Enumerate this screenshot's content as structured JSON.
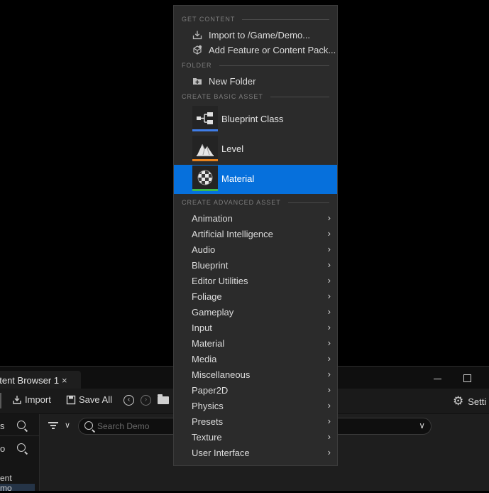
{
  "content_browser": {
    "tab_label": "ntent Browser 1",
    "tab_close": "×",
    "toolbar": {
      "import_label": "Import",
      "save_all_label": "Save All",
      "settings_label": "Setti"
    },
    "left_panel": {
      "row1": "s",
      "row2": "o",
      "tree_items": [
        "ent",
        "mo"
      ]
    },
    "search": {
      "placeholder": "Search Demo"
    }
  },
  "menu": {
    "sections": {
      "get_content": "GET CONTENT",
      "folder": "FOLDER",
      "create_basic": "CREATE BASIC ASSET",
      "create_advanced": "CREATE ADVANCED ASSET"
    },
    "get_content_items": [
      {
        "label": "Import to /Game/Demo...",
        "icon": "import-icon"
      },
      {
        "label": "Add Feature or Content Pack...",
        "icon": "content-pack-icon"
      }
    ],
    "folder_items": [
      {
        "label": "New Folder",
        "icon": "new-folder-icon"
      }
    ],
    "basic_assets": [
      {
        "label": "Blueprint Class",
        "icon": "blueprint-class-icon",
        "color": "#3f7de8"
      },
      {
        "label": "Level",
        "icon": "level-icon",
        "color": "#e8821c"
      },
      {
        "label": "Material",
        "icon": "material-icon",
        "color": "#3dba4e",
        "selected": true
      }
    ],
    "advanced_assets": [
      "Animation",
      "Artificial Intelligence",
      "Audio",
      "Blueprint",
      "Editor Utilities",
      "Foliage",
      "Gameplay",
      "Input",
      "Material",
      "Media",
      "Miscellaneous",
      "Paper2D",
      "Physics",
      "Presets",
      "Texture",
      "User Interface"
    ],
    "submenu_chevron": "›"
  },
  "colors": {
    "selection": "#0670dc",
    "menu_bg": "#2b2b2b"
  }
}
